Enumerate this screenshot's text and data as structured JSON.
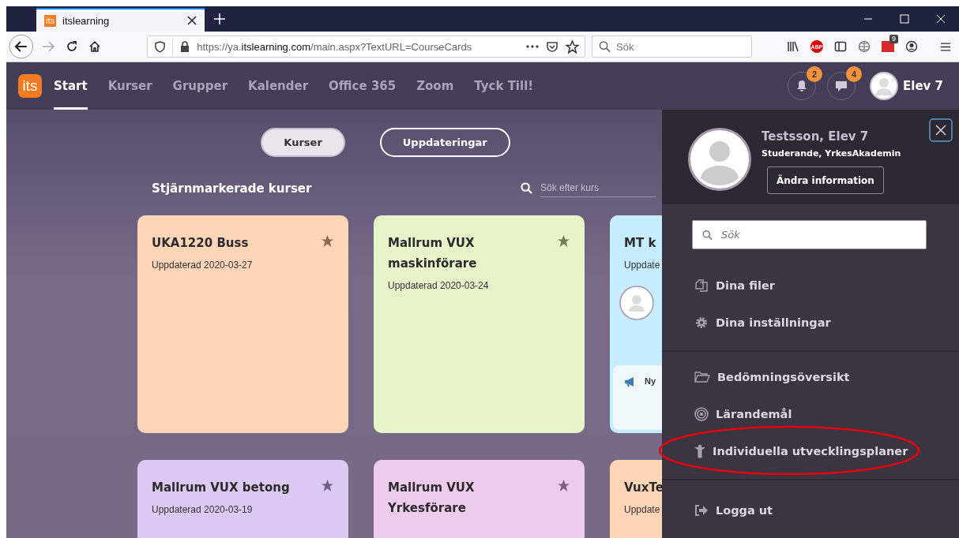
{
  "browser": {
    "tab": {
      "title": "itslearning",
      "favicon": "its"
    },
    "url": {
      "host_prefix": "https://ya.",
      "host": "itslearning.com",
      "path": "/main.aspx?TextURL=CourseCards"
    },
    "search": {
      "placeholder": "Sök"
    },
    "extension_badge": "9",
    "adblock_label": "ABP"
  },
  "header": {
    "logo": "its",
    "nav": [
      {
        "label": "Start",
        "selected": true
      },
      {
        "label": "Kurser",
        "selected": false
      },
      {
        "label": "Grupper",
        "selected": false
      },
      {
        "label": "Kalender",
        "selected": false
      },
      {
        "label": "Office 365",
        "selected": false
      },
      {
        "label": "Zoom",
        "selected": false
      },
      {
        "label": "Tyck Till!",
        "selected": false
      }
    ],
    "notifications_count": "2",
    "messages_count": "4",
    "user": "Elev 7"
  },
  "view_toggle": [
    {
      "label": "Kurser",
      "selected": true
    },
    {
      "label": "Uppdateringar",
      "selected": false
    }
  ],
  "section_title": "Stjärnmarkerade kurser",
  "course_search": {
    "placeholder": "Sök efter kurs"
  },
  "courses": [
    {
      "title": "UKA1220 Buss",
      "updated": "Uppdaterad 2020-03-27",
      "color": "#ffd5b8"
    },
    {
      "title": "Mallrum VUX maskinförare",
      "updated": "Uppdaterad 2020-03-24",
      "color": "#e8f5cb"
    },
    {
      "title": "MT k",
      "updated": "Uppdate",
      "color": "#c6ecff",
      "notice": "Ny"
    },
    {
      "title": "Mallrum VUX betong",
      "updated": "Uppdaterad 2020-03-19",
      "color": "#dccaf5"
    },
    {
      "title": "Mallrum VUX Yrkesförare",
      "color": "#efcbec"
    },
    {
      "title": "VuxTe",
      "updated": "Uppdate",
      "color": "#ffd5b8"
    }
  ],
  "profile_panel": {
    "name": "Testsson, Elev 7",
    "role": "Studerande, YrkesAkademin",
    "edit_button": "Ändra information",
    "search": {
      "placeholder": "Sök"
    },
    "groups": [
      [
        {
          "label": "Dina filer",
          "kind": "files"
        },
        {
          "label": "Dina inställningar",
          "kind": "settings"
        }
      ],
      [
        {
          "label": "Bedömningsöversikt",
          "kind": "assessment"
        },
        {
          "label": "Lärandemål",
          "kind": "goals"
        },
        {
          "label": "Individuella utvecklingsplaner",
          "kind": "plans",
          "circled": true
        }
      ],
      [
        {
          "label": "Logga ut",
          "kind": "logout"
        }
      ]
    ]
  }
}
